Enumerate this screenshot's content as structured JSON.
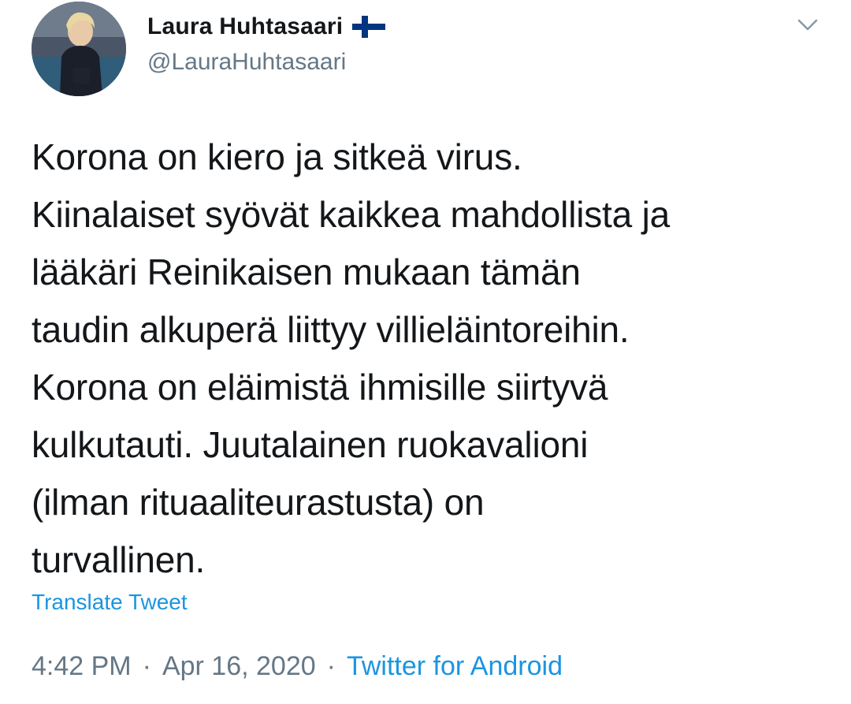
{
  "author": {
    "display_name": "Laura Huhtasaari",
    "handle": "@LauraHuhtasaari",
    "flag_icon": "finland-flag-icon"
  },
  "tweet": {
    "lines": [
      "Korona on kiero ja sitkeä virus.",
      "Kiinalaiset syövät kaikkea mahdollista ja",
      "lääkäri Reinikaisen mukaan tämän",
      "taudin alkuperä liittyy villieläintoreihin.",
      "Korona on eläimistä ihmisille siirtyvä",
      "kulkutauti. Juutalainen ruokavalioni",
      "(ilman rituaaliteurastusta) on",
      "turvallinen."
    ],
    "translate_label": "Translate Tweet"
  },
  "meta": {
    "time": "4:42 PM",
    "separator": "·",
    "date": "Apr 16, 2020",
    "source": "Twitter for Android"
  },
  "colors": {
    "text": "#14171a",
    "secondary": "#657786",
    "link": "#1b95e0",
    "flag_blue": "#003580"
  },
  "icons": {
    "menu": "chevron-down-icon"
  }
}
